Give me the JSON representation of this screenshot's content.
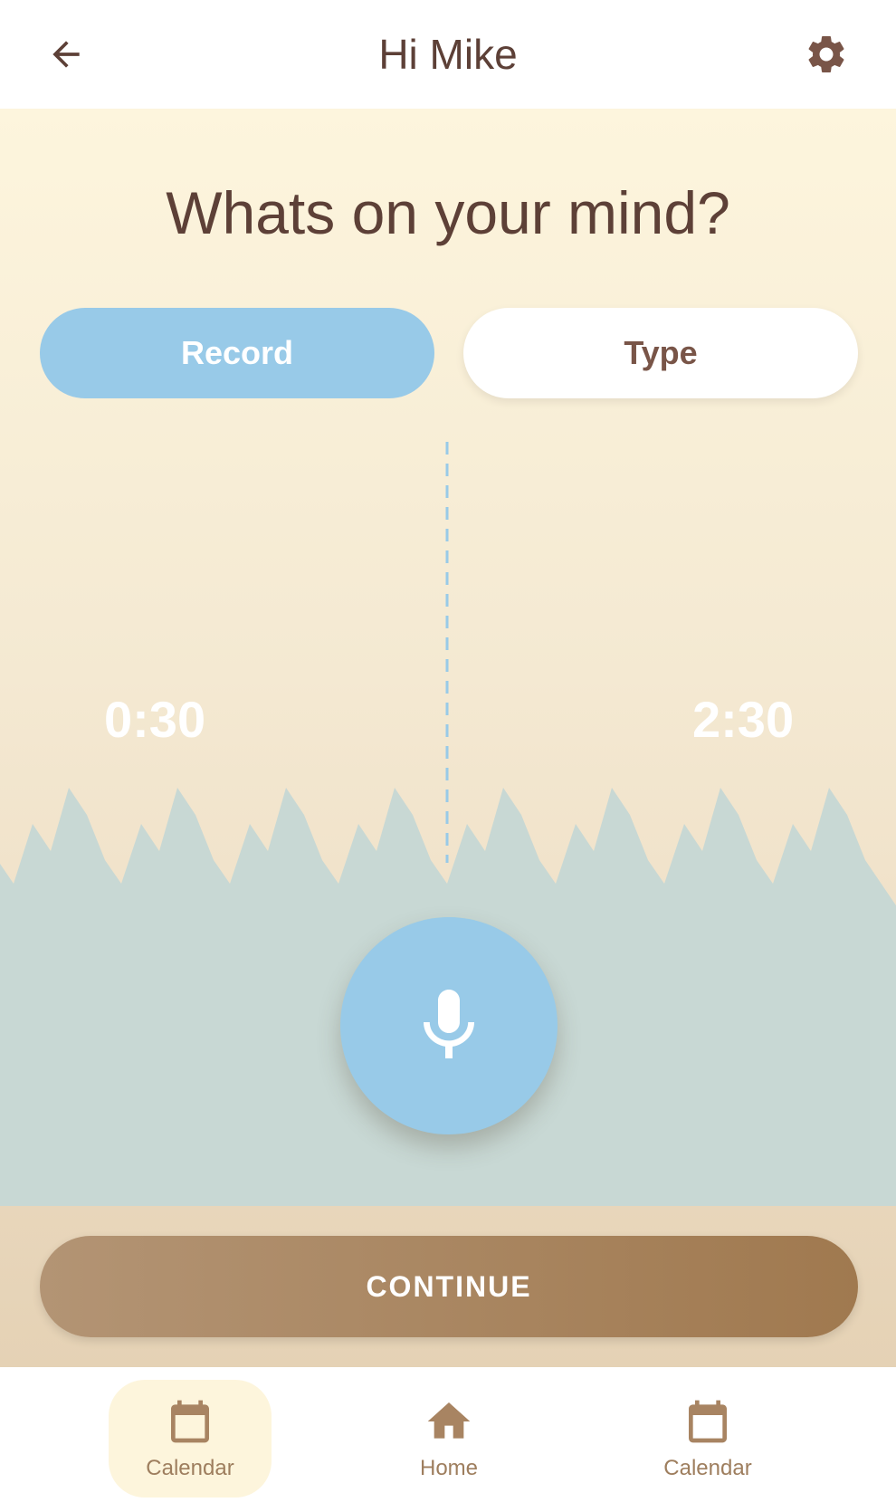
{
  "header": {
    "title": "Hi Mike",
    "back_icon": "arrow-back-icon",
    "settings_icon": "gear-icon"
  },
  "main": {
    "heading": "Whats on your mind?",
    "modes": {
      "record_label": "Record",
      "type_label": "Type",
      "selected": "Record"
    },
    "timeline": {
      "start_time": "0:30",
      "end_time": "2:30"
    },
    "mic_icon": "microphone-icon",
    "continue_label": "CONTINUE"
  },
  "bottom_nav": {
    "items": [
      {
        "label": "Calendar",
        "icon": "calendar-icon",
        "active": true
      },
      {
        "label": "Home",
        "icon": "home-icon",
        "active": false
      },
      {
        "label": "Calendar",
        "icon": "calendar-icon",
        "active": false
      }
    ]
  },
  "colors": {
    "accent_blue": "#98cae8",
    "brown_text": "#5d4037",
    "continue_brown": "#a0794f",
    "wave_fill": "#c8d8d4"
  }
}
